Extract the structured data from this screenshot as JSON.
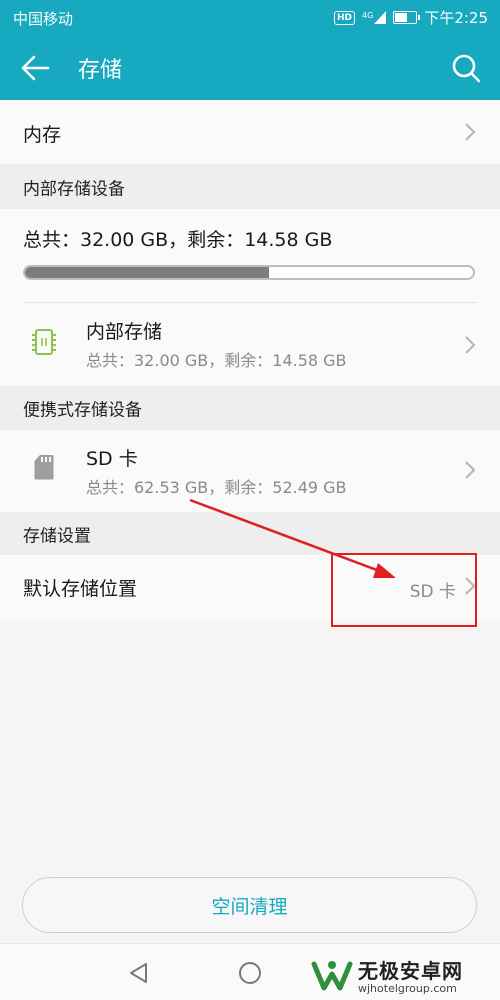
{
  "status_bar": {
    "carrier": "中国移动",
    "network": "4G",
    "hd": "HD",
    "time": "下午2:25"
  },
  "app_bar": {
    "title": "存储",
    "back_icon": "arrow-left-icon",
    "search_icon": "search-icon"
  },
  "memory_row": {
    "label": "内存"
  },
  "internal_section": {
    "header": "内部存储设备",
    "summary": "总共：32.00 GB，剩余：14.58 GB",
    "used_fraction": 0.545,
    "device": {
      "name": "内部存储",
      "detail": "总共：32.00 GB，剩余：14.58 GB",
      "icon": "chip-icon"
    }
  },
  "portable_section": {
    "header": "便携式存储设备",
    "device": {
      "name": "SD 卡",
      "detail": "总共：62.53 GB，剩余：52.49 GB",
      "icon": "sd-card-icon"
    }
  },
  "settings_section": {
    "header": "存储设置",
    "default_location": {
      "label": "默认存储位置",
      "value": "SD 卡"
    }
  },
  "clean_button": {
    "label": "空间清理"
  },
  "colors": {
    "accent": "#16a9bf",
    "progress_fill": "#7d7d7d",
    "annotation": "#e02020"
  },
  "watermark": {
    "title": "无极安卓网",
    "url": "wjhotelgroup.com"
  }
}
